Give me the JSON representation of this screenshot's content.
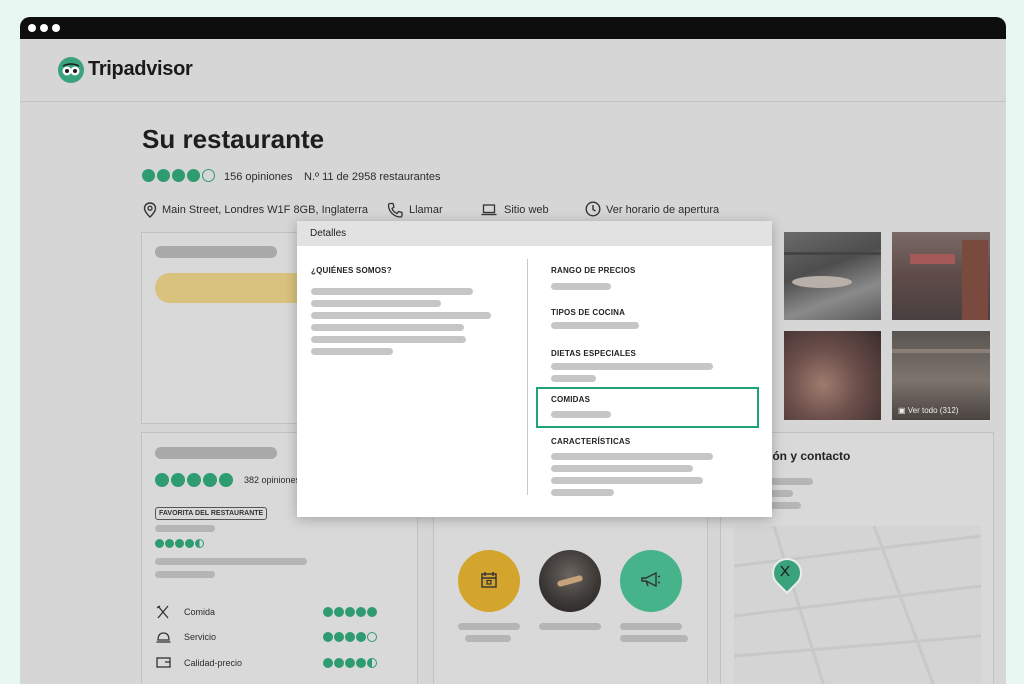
{
  "brand": {
    "name": "Tripadvisor",
    "accent": "#34b08a"
  },
  "restaurant": {
    "name": "Su restaurante",
    "rating_bubbles": 4,
    "reviews": "156 opiniones",
    "ranking": "N.º 11 de 2958 restaurantes",
    "address": "Main Street, Londres W1F 8GB, Inglaterra",
    "actions": {
      "call": "Llamar",
      "website": "Sitio web",
      "hours": "Ver horario de apertura"
    }
  },
  "photos": {
    "view_all": "Ver todo (312)"
  },
  "ratings_card": {
    "reviews": "382 opiniones",
    "badge": "FAVORITA DEL RESTAURANTE",
    "rows": [
      {
        "label": "Comida",
        "icon": "fork-knife-icon",
        "value": 5
      },
      {
        "label": "Servicio",
        "icon": "cloche-icon",
        "value": 4
      },
      {
        "label": "Calidad-precio",
        "icon": "wallet-icon",
        "value": 4.5
      }
    ]
  },
  "location_card": {
    "title": "ión y contacto"
  },
  "feature_circles": [
    {
      "icon": "calendar-icon",
      "color": "#d4a52c"
    },
    {
      "icon": "musician-photo",
      "color": "#3a3a3a"
    },
    {
      "icon": "megaphone-icon",
      "color": "#46b38a"
    }
  ],
  "modal": {
    "title": "Detalles",
    "about_label": "¿QUIÉNES SOMOS?",
    "sections": [
      "RANGO DE PRECIOS",
      "TIPOS DE COCINA",
      "DIETAS ESPECIALES",
      "COMIDAS",
      "CARACTERÍSTICAS"
    ],
    "highlighted_section": "COMIDAS",
    "highlight_color": "#1fa474"
  }
}
